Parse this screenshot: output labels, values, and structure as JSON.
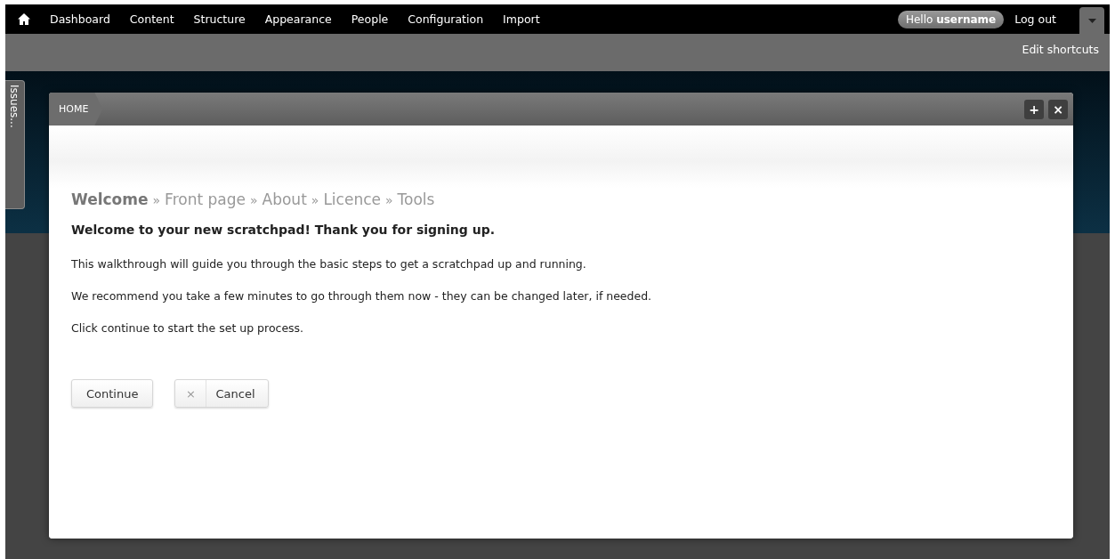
{
  "toolbar": {
    "menu": [
      "Dashboard",
      "Content",
      "Structure",
      "Appearance",
      "People",
      "Configuration",
      "Import"
    ],
    "greeting": "Hello **username**",
    "logout": "Log out"
  },
  "shortcuts": {
    "edit_link": "Edit shortcuts"
  },
  "side_tab": {
    "label": "Issues..."
  },
  "dialog": {
    "breadcrumb": [
      "HOME"
    ],
    "actions": [
      "+",
      "×"
    ],
    "separator": "»",
    "steps": [
      {
        "label": "Welcome",
        "selected": true
      },
      {
        "label": "Front page",
        "selected": false
      },
      {
        "label": "About",
        "selected": false
      },
      {
        "label": "Licence",
        "selected": false
      },
      {
        "label": "Tools",
        "selected": false
      }
    ],
    "heading": "Welcome to your new scratchpad! Thank you for signing up.",
    "paragraphs": [
      "This walkthrough will guide you through the basic steps to get a scratchpad up and running.",
      "We recommend you take a few minutes to go through them now - they can be changed later, if needed.",
      "Click continue to start the set up process."
    ],
    "buttons": [
      {
        "label": "Continue",
        "kind": "primary"
      },
      {
        "label": "Cancel",
        "kind": "cancel",
        "icon": "×"
      }
    ]
  }
}
